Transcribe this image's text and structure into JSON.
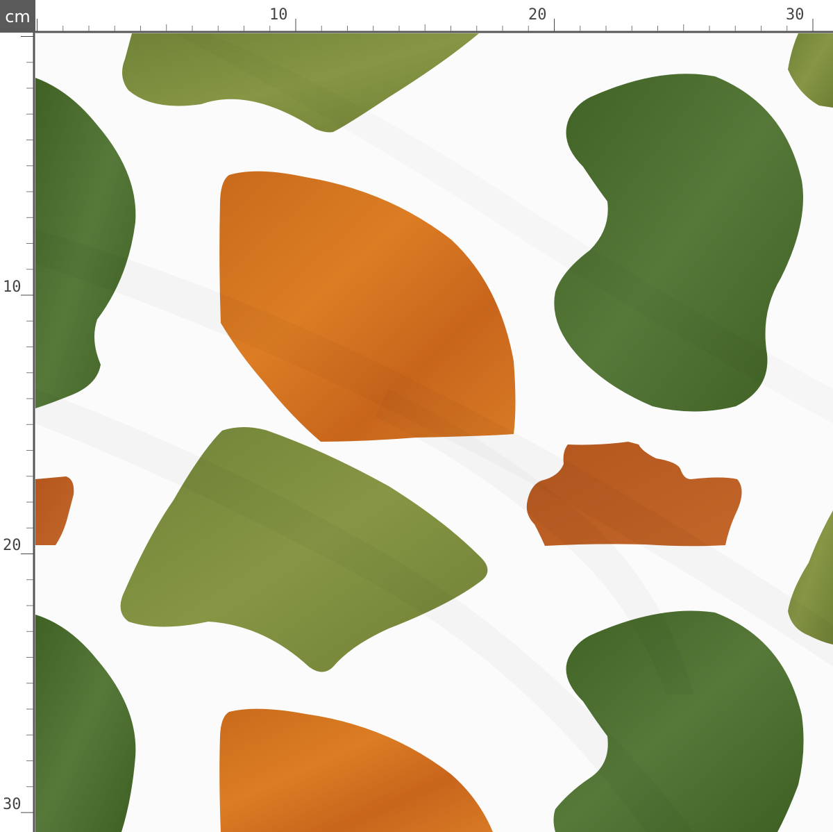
{
  "ruler": {
    "unit": "cm",
    "top_labels": [
      "10",
      "20",
      "30"
    ],
    "left_labels": [
      "10",
      "20",
      "30"
    ]
  },
  "fabric": {
    "background": "#fbfbfb",
    "colors": {
      "olive": "#7e8f43",
      "forest": "#4c6e2c",
      "orange": "#d2721f",
      "rust": "#b8591f",
      "shadow": "#d8d8d8"
    }
  }
}
